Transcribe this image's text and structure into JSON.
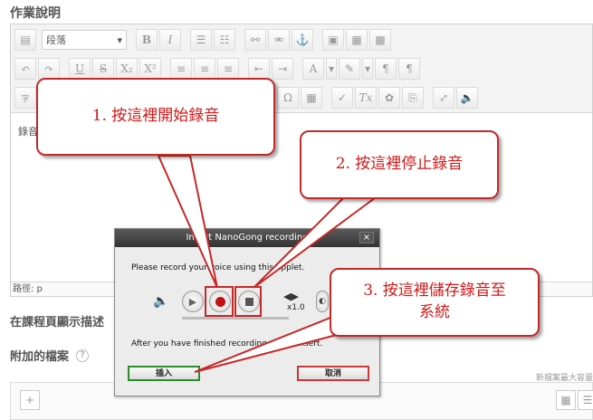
{
  "page": {
    "section_title": "作業說明",
    "desc_option_label": "在課程頁顯示描述",
    "files_title": "附加的檔案",
    "max_size_note": "新檔案最大容量"
  },
  "toolbar": {
    "format_select": "段落",
    "row3_label": "字"
  },
  "editor": {
    "content_text": "錄音",
    "path_label": "路徑: p"
  },
  "dialog": {
    "title": "Insert NanoGong recording",
    "close_label": "×",
    "instruction": "Please record your voice using this applet.",
    "speed_label": "x1.0",
    "after_text": "After you have finished recording, press Insert.",
    "insert_button": "插入",
    "cancel_button": "取消"
  },
  "callouts": {
    "step1": "1. 按這裡開始錄音",
    "step2": "2. 按這裡停止錄音",
    "step3_line1": "3. 按這裡儲存錄音至",
    "step3_line2": "系統"
  },
  "colors": {
    "callout_border": "#c62828",
    "callout_text": "#d01818",
    "record_dot": "#c41010"
  }
}
